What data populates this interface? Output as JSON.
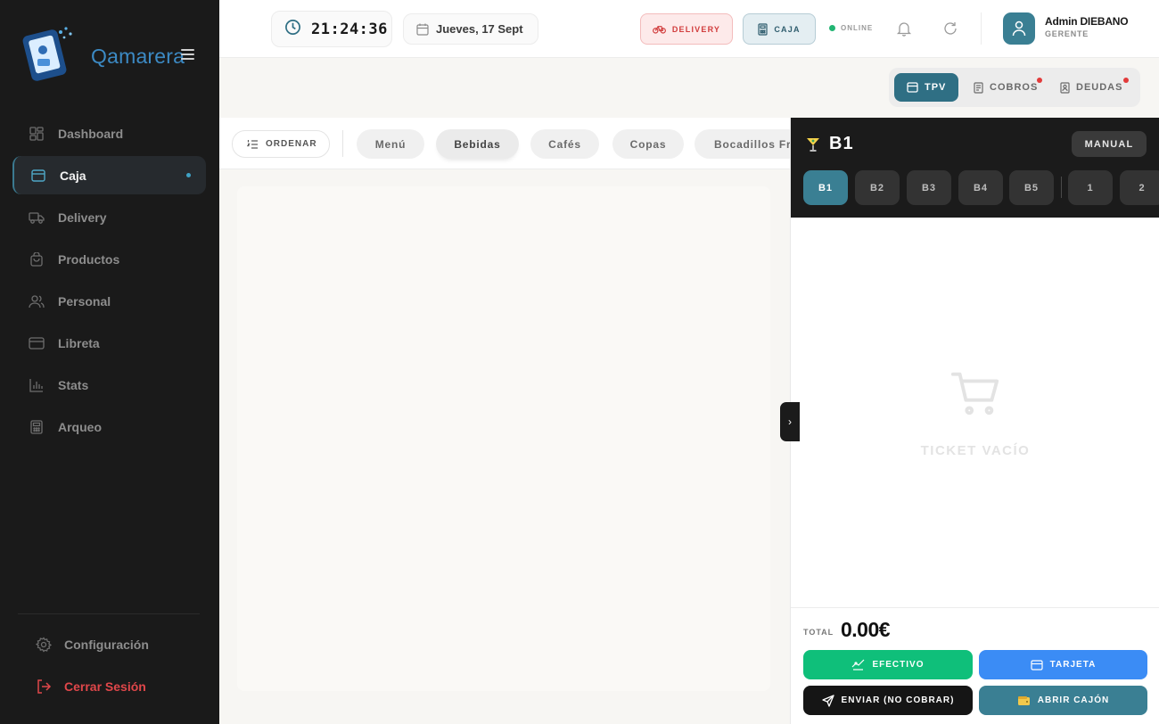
{
  "app": {
    "name": "Qamarera"
  },
  "sidebar": {
    "items": [
      {
        "label": "Dashboard",
        "icon": "dashboard-icon",
        "active": false
      },
      {
        "label": "Caja",
        "icon": "cash-register-icon",
        "active": true
      },
      {
        "label": "Delivery",
        "icon": "truck-icon",
        "active": false
      },
      {
        "label": "Productos",
        "icon": "shopping-bag-icon",
        "active": false
      },
      {
        "label": "Personal",
        "icon": "users-icon",
        "active": false
      },
      {
        "label": "Libreta",
        "icon": "credit-card-icon",
        "active": false
      },
      {
        "label": "Stats",
        "icon": "bar-chart-icon",
        "active": false
      },
      {
        "label": "Arqueo",
        "icon": "calculator-icon",
        "active": false
      }
    ],
    "settings_label": "Configuración",
    "logout_label": "Cerrar Sesión"
  },
  "header": {
    "time": "21:24:36",
    "date": "Jueves, 17 Sept",
    "delivery_label": "DELIVERY",
    "caja_label": "CAJA",
    "status_label": "ONLINE",
    "user_name": "Admin DIEBANO",
    "user_role": "GERENTE"
  },
  "modes": [
    {
      "label": "TPV",
      "active": true,
      "badge": false
    },
    {
      "label": "COBROS",
      "active": false,
      "badge": true
    },
    {
      "label": "DEUDAS",
      "active": false,
      "badge": true
    }
  ],
  "categories": {
    "order_label": "ORDENAR",
    "items": [
      "Menú",
      "Bebidas",
      "Cafés",
      "Copas",
      "Bocadillos Fr"
    ],
    "active": "Bebidas"
  },
  "ticket": {
    "title": "B1",
    "manual_label": "MANUAL",
    "tables": [
      "B1",
      "B2",
      "B3",
      "B4",
      "B5",
      "1",
      "2"
    ],
    "active_table": "B1",
    "empty_label": "TICKET VACÍO",
    "total_label": "TOTAL",
    "total_value": "0.00€",
    "buttons": {
      "cash": "EFECTIVO",
      "card": "TARJETA",
      "send": "ENVIAR (NO COBRAR)",
      "drawer": "ABRIR CAJÓN"
    }
  },
  "colors": {
    "accent": "#2f6f84",
    "cash": "#0fbf7a",
    "card": "#3b8cf5",
    "danger": "#d13c3c",
    "online": "#22b573"
  }
}
